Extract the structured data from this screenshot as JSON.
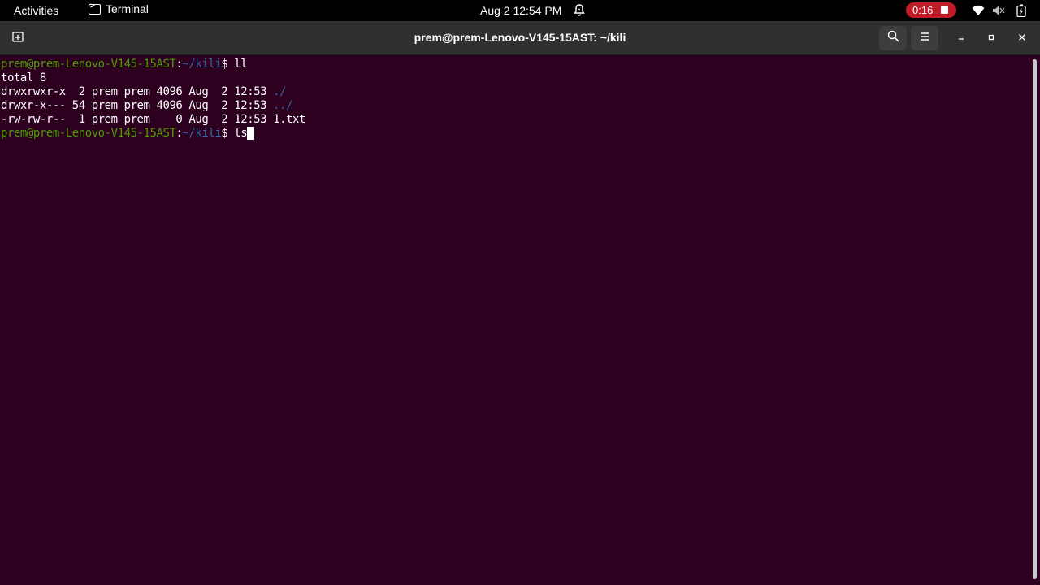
{
  "topbar": {
    "activities": "Activities",
    "app_name": "Terminal",
    "clock": "Aug 2  12:54 PM",
    "recording_time": "0:16",
    "icons": [
      "terminal-icon",
      "bell-icon",
      "stop-icon",
      "wifi-icon",
      "volume-icon",
      "battery-icon"
    ]
  },
  "window": {
    "title": "prem@prem-Lenovo-V145-15AST: ~/kili",
    "icons": [
      "new-tab-icon",
      "search-icon",
      "hamburger-menu-icon",
      "minimize-icon",
      "maximize-icon",
      "close-icon"
    ]
  },
  "terminal": {
    "colors": {
      "background": "#2c001e",
      "user": "#4e9a06",
      "path": "#3465a4",
      "text": "#ffffff"
    },
    "line1": {
      "user": "prem@prem-Lenovo-V145-15AST",
      "sep": ":",
      "path": "~/kili",
      "dollar": "$ ",
      "command": "ll"
    },
    "line2": "total 8",
    "line3": {
      "meta": "drwxrwxr-x  2 prem prem 4096 Aug  2 12:53 ",
      "name": "./"
    },
    "line4": {
      "meta": "drwxr-x--- 54 prem prem 4096 Aug  2 12:53 ",
      "name": "../"
    },
    "line5": {
      "meta": "-rw-rw-r--  1 prem prem    0 Aug  2 12:53 ",
      "name": "1.txt"
    },
    "line6": {
      "user": "prem@prem-Lenovo-V145-15AST",
      "sep": ":",
      "path": "~/kili",
      "dollar": "$ ",
      "command": "ls"
    }
  }
}
